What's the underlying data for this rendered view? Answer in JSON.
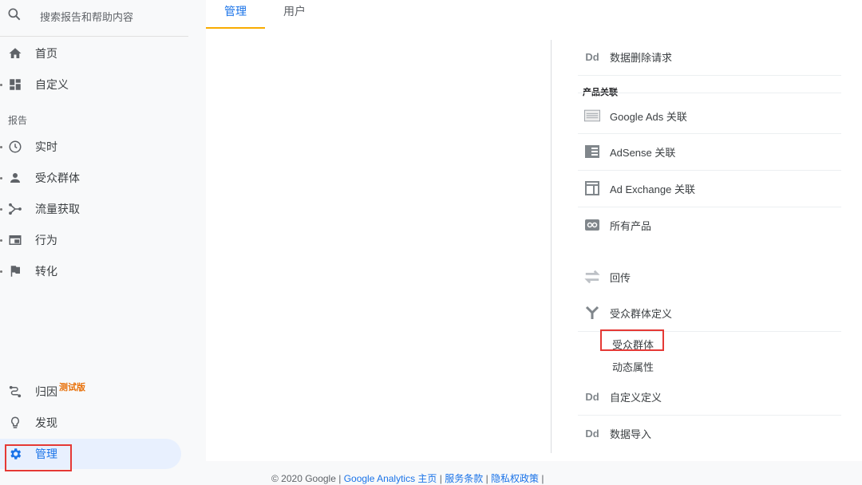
{
  "sidebar": {
    "search_placeholder": "搜索报告和帮助内容",
    "top_items": [
      {
        "label": "首页"
      },
      {
        "label": "自定义"
      }
    ],
    "section_label": "报告",
    "report_items": [
      {
        "label": "实时"
      },
      {
        "label": "受众群体"
      },
      {
        "label": "流量获取"
      },
      {
        "label": "行为"
      },
      {
        "label": "转化"
      }
    ],
    "bottom_items": [
      {
        "label": "归因",
        "badge": "测试版"
      },
      {
        "label": "发现"
      },
      {
        "label": "管理"
      }
    ]
  },
  "tabs": [
    {
      "label": "管理"
    },
    {
      "label": "用户"
    }
  ],
  "panel": {
    "data_deletion": "数据删除请求",
    "product_linking_header": "产品关联",
    "google_ads": "Google Ads 关联",
    "adsense": "AdSense 关联",
    "ad_exchange": "Ad Exchange 关联",
    "all_products": "所有产品",
    "postbacks": "回传",
    "audience_definitions": "受众群体定义",
    "audiences": "受众群体",
    "dynamic_attributes": "动态属性",
    "custom_definitions": "自定义定义",
    "data_import": "数据导入",
    "dd_icon_text": "Dd"
  },
  "footer": {
    "copyright": "© 2020 Google |",
    "ga_home": "Google Analytics 主页",
    "terms": "服务条款",
    "privacy": "隐私权政策"
  },
  "colors": {
    "accent": "#1a73e8",
    "tab_underline": "#f9ab00",
    "highlight_box": "#e53935",
    "beta": "#e8710a"
  }
}
